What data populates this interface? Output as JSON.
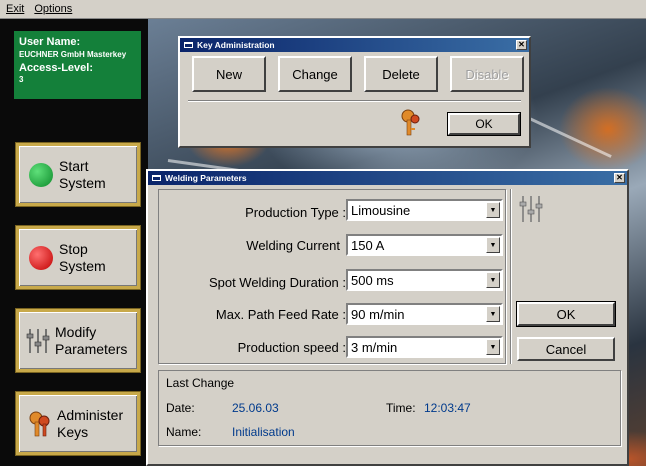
{
  "menu": {
    "items": [
      "Exit",
      "Options"
    ]
  },
  "user": {
    "name_label": "User Name:",
    "name_value": "EUCHNER GmbH Masterkey",
    "access_label": "Access-Level:",
    "access_value": "3"
  },
  "sidebar": {
    "start": {
      "line1": "Start",
      "line2": "System"
    },
    "stop": {
      "line1": "Stop",
      "line2": "System"
    },
    "modify": {
      "line1": "Modify",
      "line2": "Parameters"
    },
    "keys": {
      "line1": "Administer",
      "line2": "Keys"
    }
  },
  "key_admin": {
    "title": "Key Administration",
    "new_label": "New",
    "change_label": "Change",
    "delete_label": "Delete",
    "disable_label": "Disable",
    "ok_label": "OK"
  },
  "welding": {
    "title": "Welding Parameters",
    "params": [
      {
        "label": "Production Type :",
        "value": "Limousine"
      },
      {
        "label": "Welding Current",
        "value": "150 A"
      },
      {
        "label": "Spot Welding Duration :",
        "value": "500 ms"
      },
      {
        "label": "Max. Path Feed Rate :",
        "value": "90 m/min"
      },
      {
        "label": "Production speed :",
        "value": "3 m/min"
      }
    ],
    "ok_label": "OK",
    "cancel_label": "Cancel",
    "last_change": {
      "heading": "Last Change",
      "date_label": "Date:",
      "date_value": "25.06.03",
      "time_label": "Time:",
      "time_value": "12:03:47",
      "name_label": "Name:",
      "name_value": "Initialisation"
    }
  },
  "colors": {
    "user_box": "#14803a",
    "titlebar": "#0a246a",
    "button_frame": "#c8a94a"
  }
}
